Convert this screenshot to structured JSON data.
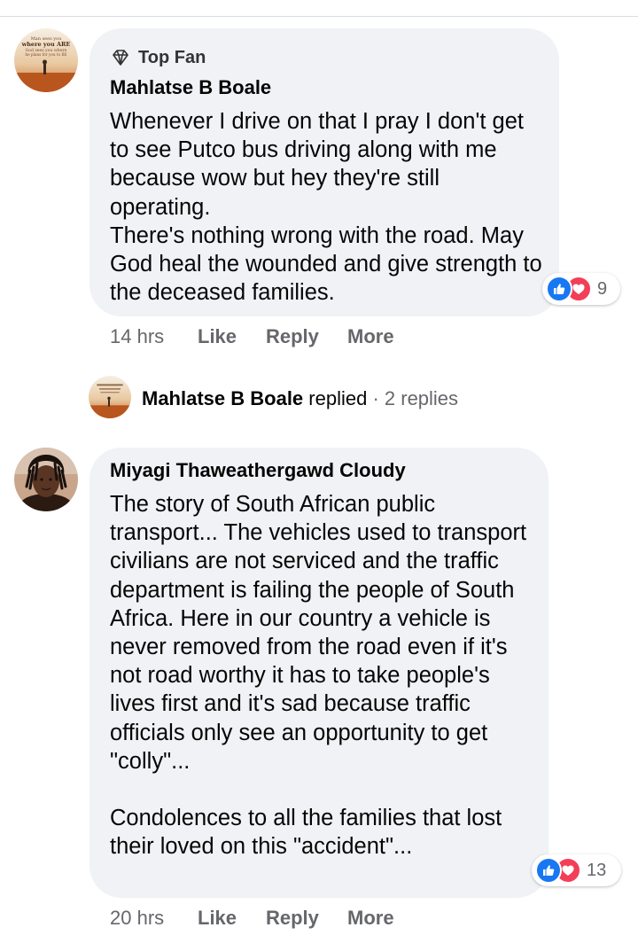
{
  "comments": [
    {
      "badge": "Top Fan",
      "badge_icon": "diamond-icon",
      "author": "Mahlatse B Boale",
      "text": "Whenever I drive on that I pray I don't get to see Putco bus driving along with me because wow but hey they're still operating.\nThere's nothing wrong with the road. May God heal the wounded and give strength to the deceased families.",
      "reactions": [
        "like",
        "love"
      ],
      "reaction_count": "9",
      "time": "14 hrs",
      "like_label": "Like",
      "reply_label": "Reply",
      "more_label": "More"
    },
    {
      "author": "Miyagi Thaweathergawd Cloudy",
      "text": "The story of South African public transport... The vehicles used to transport civilians are not serviced and the traffic department is failing the people of South Africa. Here in our country a vehicle is never removed from the road even if it's not road worthy it has to take people's lives first and it's sad because traffic officials only see an opportunity to get \"colly\"...\n\nCondolences to all the families that lost their loved on this \"accident\"...",
      "reactions": [
        "like",
        "love"
      ],
      "reaction_count": "13",
      "time": "20 hrs",
      "like_label": "Like",
      "reply_label": "Reply",
      "more_label": "More"
    }
  ],
  "reply_summary": {
    "name": "Mahlatse B Boale",
    "verb": " replied",
    "separator": " · ",
    "count": "2 replies"
  },
  "avatar_text": [
    "Man sees you",
    "where you ARE",
    "God sees you where",
    "he plans for you to BE"
  ],
  "colors": {
    "bubble": "#f0f2f5",
    "like_blue": "#1877f2",
    "love_red": "#f33e58",
    "meta_gray": "#65676b"
  }
}
